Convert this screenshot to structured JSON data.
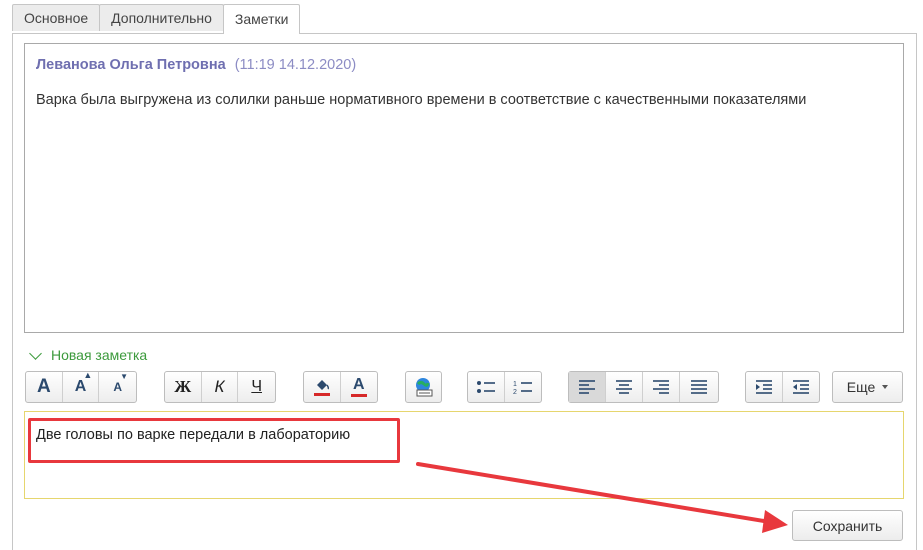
{
  "tabs": [
    {
      "label": "Основное",
      "active": false
    },
    {
      "label": "Дополнительно",
      "active": false
    },
    {
      "label": "Заметки",
      "active": true
    }
  ],
  "note": {
    "author": "Леванова Ольга Петровна",
    "time": "(11:19 14.12.2020)",
    "text": "Варка была выгружена из солилки раньше нормативного времени в соответствие с качественными показателями"
  },
  "new_note": {
    "label": "Новая заметка",
    "expanded": true
  },
  "toolbar": {
    "font_increase": "A",
    "font_size_up": "A",
    "font_size_down": "A",
    "bold": "Ж",
    "italic": "К",
    "underline": "Ч",
    "font_color": "A",
    "more_label": "Еще"
  },
  "editor": {
    "text": "Две головы по варке передали в лабораторию"
  },
  "save_label": "Сохранить",
  "colors": {
    "author": "#6f6fb0",
    "new_note": "#3c9a3c",
    "highlight": "#e8383d",
    "editor_border": "#e6d66e"
  }
}
